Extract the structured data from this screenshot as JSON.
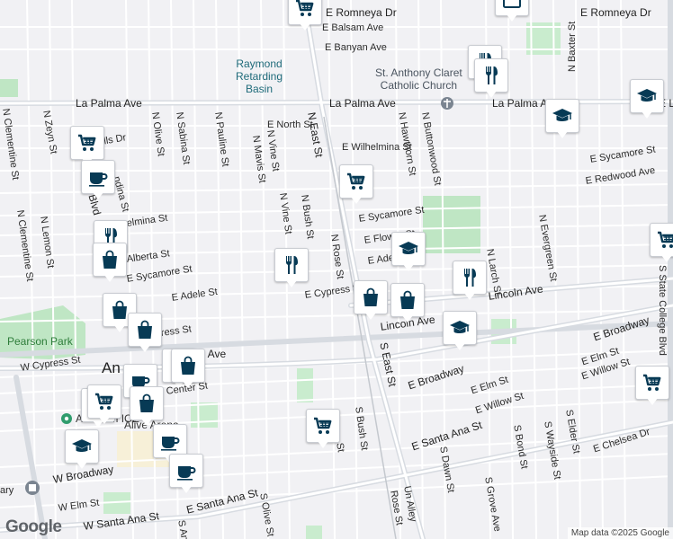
{
  "map": {
    "attribution": "Map data ©2025 Google",
    "logo": "Google"
  },
  "street_labels": [
    {
      "id": "e-romneya-dr-1",
      "text": "E Romneya Dr"
    },
    {
      "id": "e-romneya-dr-2",
      "text": "E Romneya Dr"
    },
    {
      "id": "e-balsam-ave",
      "text": "E Balsam Ave"
    },
    {
      "id": "e-banyan-ave",
      "text": "E Banyan Ave"
    },
    {
      "id": "n-baxter-st",
      "text": "N Baxter St"
    },
    {
      "id": "la-palma-ave-1",
      "text": "La Palma Ave"
    },
    {
      "id": "la-palma-ave-2",
      "text": "La Palma Ave"
    },
    {
      "id": "la-palma-ave-3",
      "text": "La Palma Ave"
    },
    {
      "id": "e-la-partial",
      "text": "E L"
    },
    {
      "id": "e-north-st",
      "text": "E North St"
    },
    {
      "id": "n-east-st-1",
      "text": "N East St"
    },
    {
      "id": "e-wilhelmina-st-1",
      "text": "E Wilhelmina St"
    },
    {
      "id": "n-hawthorn-st",
      "text": "N Hawthorn St"
    },
    {
      "id": "n-buttonwood-st",
      "text": "N Buttonwood St"
    },
    {
      "id": "e-sycamore-st-1",
      "text": "E Sycamore St"
    },
    {
      "id": "e-redwood-ave",
      "text": "E Redwood Ave"
    },
    {
      "id": "n-zeyn-st",
      "text": "N Zeyn St"
    },
    {
      "id": "n-clementine-st-1",
      "text": "N Clementine St"
    },
    {
      "id": "n-olive-st",
      "text": "N Olive St"
    },
    {
      "id": "n-sabina-st",
      "text": "N Sabina St"
    },
    {
      "id": "n-pauline-st",
      "text": "N Pauline St"
    },
    {
      "id": "n-vine-st-1",
      "text": "N Vine St"
    },
    {
      "id": "n-mavis-st",
      "text": "N Mavis St"
    },
    {
      "id": "n-vine-st-2",
      "text": "N Vine St"
    },
    {
      "id": "n-bush-st",
      "text": "N Bush St"
    },
    {
      "id": "n-rose-st",
      "text": "N Rose St"
    },
    {
      "id": "e-sycamore-st-2",
      "text": "E Sycamore St"
    },
    {
      "id": "e-flower-st",
      "text": "E Flower St"
    },
    {
      "id": "e-adele-st-1",
      "text": "E Adele St"
    },
    {
      "id": "n-evergreen-st",
      "text": "N Evergreen St"
    },
    {
      "id": "n-larch-st",
      "text": "N Larch St"
    },
    {
      "id": "s-state-college-blvd",
      "text": "S State College Blvd"
    },
    {
      "id": "ills-dr",
      "text": "ills Dr"
    },
    {
      "id": "ndina-st",
      "text": "ndina St"
    },
    {
      "id": "blvd",
      "text": "Blvd"
    },
    {
      "id": "elmina-st",
      "text": "elmina St"
    },
    {
      "id": "n-lemon-st",
      "text": "N Lemon St"
    },
    {
      "id": "n-clementine-st-2",
      "text": "N Clementine St"
    },
    {
      "id": "alberta-st",
      "text": "Alberta St"
    },
    {
      "id": "e-sycamore-st-3",
      "text": "E Sycamore St"
    },
    {
      "id": "e-adele-st-2",
      "text": "E Adele St"
    },
    {
      "id": "e-cypress-st",
      "text": "E Cypress St"
    },
    {
      "id": "lincoln-ave-1",
      "text": "Lincoln Ave"
    },
    {
      "id": "lincoln-ave-2",
      "text": "Lincoln Ave"
    },
    {
      "id": "e-broadway-1",
      "text": "E Broadway"
    },
    {
      "id": "e-broadway-2",
      "text": "E Broadway"
    },
    {
      "id": "s-east-st",
      "text": "S East St"
    },
    {
      "id": "press-st",
      "text": "press St"
    },
    {
      "id": "w-cypress-st",
      "text": "W Cypress St"
    },
    {
      "id": "coln-ave",
      "text": "coln Ave"
    },
    {
      "id": "center-st",
      "text": "Center St"
    },
    {
      "id": "e-elm-st-1",
      "text": "E Elm St"
    },
    {
      "id": "e-elm-st-2",
      "text": "E Elm St"
    },
    {
      "id": "e-willow-st-1",
      "text": "E Willow St"
    },
    {
      "id": "e-willow-st-2",
      "text": "E Willow St"
    },
    {
      "id": "e-santa-ana-st-1",
      "text": "E Santa Ana St"
    },
    {
      "id": "s-bush-st",
      "text": "S Bush St"
    },
    {
      "id": "s-dawn-st",
      "text": "S Dawn St"
    },
    {
      "id": "s-bond-st",
      "text": "S Bond St"
    },
    {
      "id": "s-wayside-st",
      "text": "S Wayside St"
    },
    {
      "id": "s-elder-st",
      "text": "S Elder St"
    },
    {
      "id": "e-chelsea-dr",
      "text": "E Chelsea Dr"
    },
    {
      "id": "s-grove-ave",
      "text": "S Grove Ave"
    },
    {
      "id": "un-alley",
      "text": "Un Alley"
    },
    {
      "id": "rose-st",
      "text": "Rose St"
    },
    {
      "id": "st-partial",
      "text": "St"
    },
    {
      "id": "w-broadway",
      "text": "W Broadway"
    },
    {
      "id": "w-elm-st",
      "text": "W Elm St"
    },
    {
      "id": "w-santa-ana-st",
      "text": "W Santa Ana St"
    },
    {
      "id": "e-santa-ana-st-2",
      "text": "E Santa Ana St"
    },
    {
      "id": "s-olive-st",
      "text": "S Olive St"
    },
    {
      "id": "s-an",
      "text": "S An"
    },
    {
      "id": "ary",
      "text": "ary"
    },
    {
      "id": "an",
      "text": "An"
    },
    {
      "id": "a-partial",
      "text": "a"
    }
  ],
  "poi_labels": [
    {
      "id": "raymond-basin",
      "text": "Raymond\nRetarding\nBasin",
      "kind": "poi"
    },
    {
      "id": "st-anthony",
      "text": "St. Anthony Claret\nCatholic Church",
      "kind": "church"
    },
    {
      "id": "pearson-park",
      "text": "Pearson Park",
      "kind": "park"
    },
    {
      "id": "anaheim-ice",
      "text": "Anaheim ICE",
      "kind": "place"
    },
    {
      "id": "alive-arena",
      "text": "Alive Arena",
      "kind": "place"
    }
  ],
  "markers": [
    {
      "id": "m1",
      "icon": "cart"
    },
    {
      "id": "m2",
      "icon": "calendar"
    },
    {
      "id": "m3",
      "icon": "fork"
    },
    {
      "id": "m4",
      "icon": "fork"
    },
    {
      "id": "m5",
      "icon": "school"
    },
    {
      "id": "m6",
      "icon": "school"
    },
    {
      "id": "m7",
      "icon": "cart"
    },
    {
      "id": "m8",
      "icon": "cart"
    },
    {
      "id": "m9",
      "icon": "cup"
    },
    {
      "id": "m10",
      "icon": "fork"
    },
    {
      "id": "m11",
      "icon": "bag"
    },
    {
      "id": "m12",
      "icon": "fork"
    },
    {
      "id": "m13",
      "icon": "school"
    },
    {
      "id": "m14",
      "icon": "fork"
    },
    {
      "id": "m15",
      "icon": "bag"
    },
    {
      "id": "m16",
      "icon": "bag"
    },
    {
      "id": "m17",
      "icon": "bag"
    },
    {
      "id": "m18",
      "icon": "bag"
    },
    {
      "id": "m19",
      "icon": "school"
    },
    {
      "id": "m20",
      "icon": "cart"
    },
    {
      "id": "m21",
      "icon": "bag"
    },
    {
      "id": "m22",
      "icon": "cup"
    },
    {
      "id": "m23",
      "icon": "bag"
    },
    {
      "id": "m24",
      "icon": "cart"
    },
    {
      "id": "m25",
      "icon": "bag"
    },
    {
      "id": "m26",
      "icon": "cart"
    },
    {
      "id": "m27",
      "icon": "cart"
    },
    {
      "id": "m28",
      "icon": "cup"
    },
    {
      "id": "m29",
      "icon": "school"
    },
    {
      "id": "m30",
      "icon": "cup"
    },
    {
      "id": "m31",
      "icon": "cart"
    }
  ],
  "colors": {
    "marker_icon": "#073a55",
    "road_major": "#d6dae0",
    "park": "#bfe6c4",
    "water_pin": "#2f9c6d"
  }
}
